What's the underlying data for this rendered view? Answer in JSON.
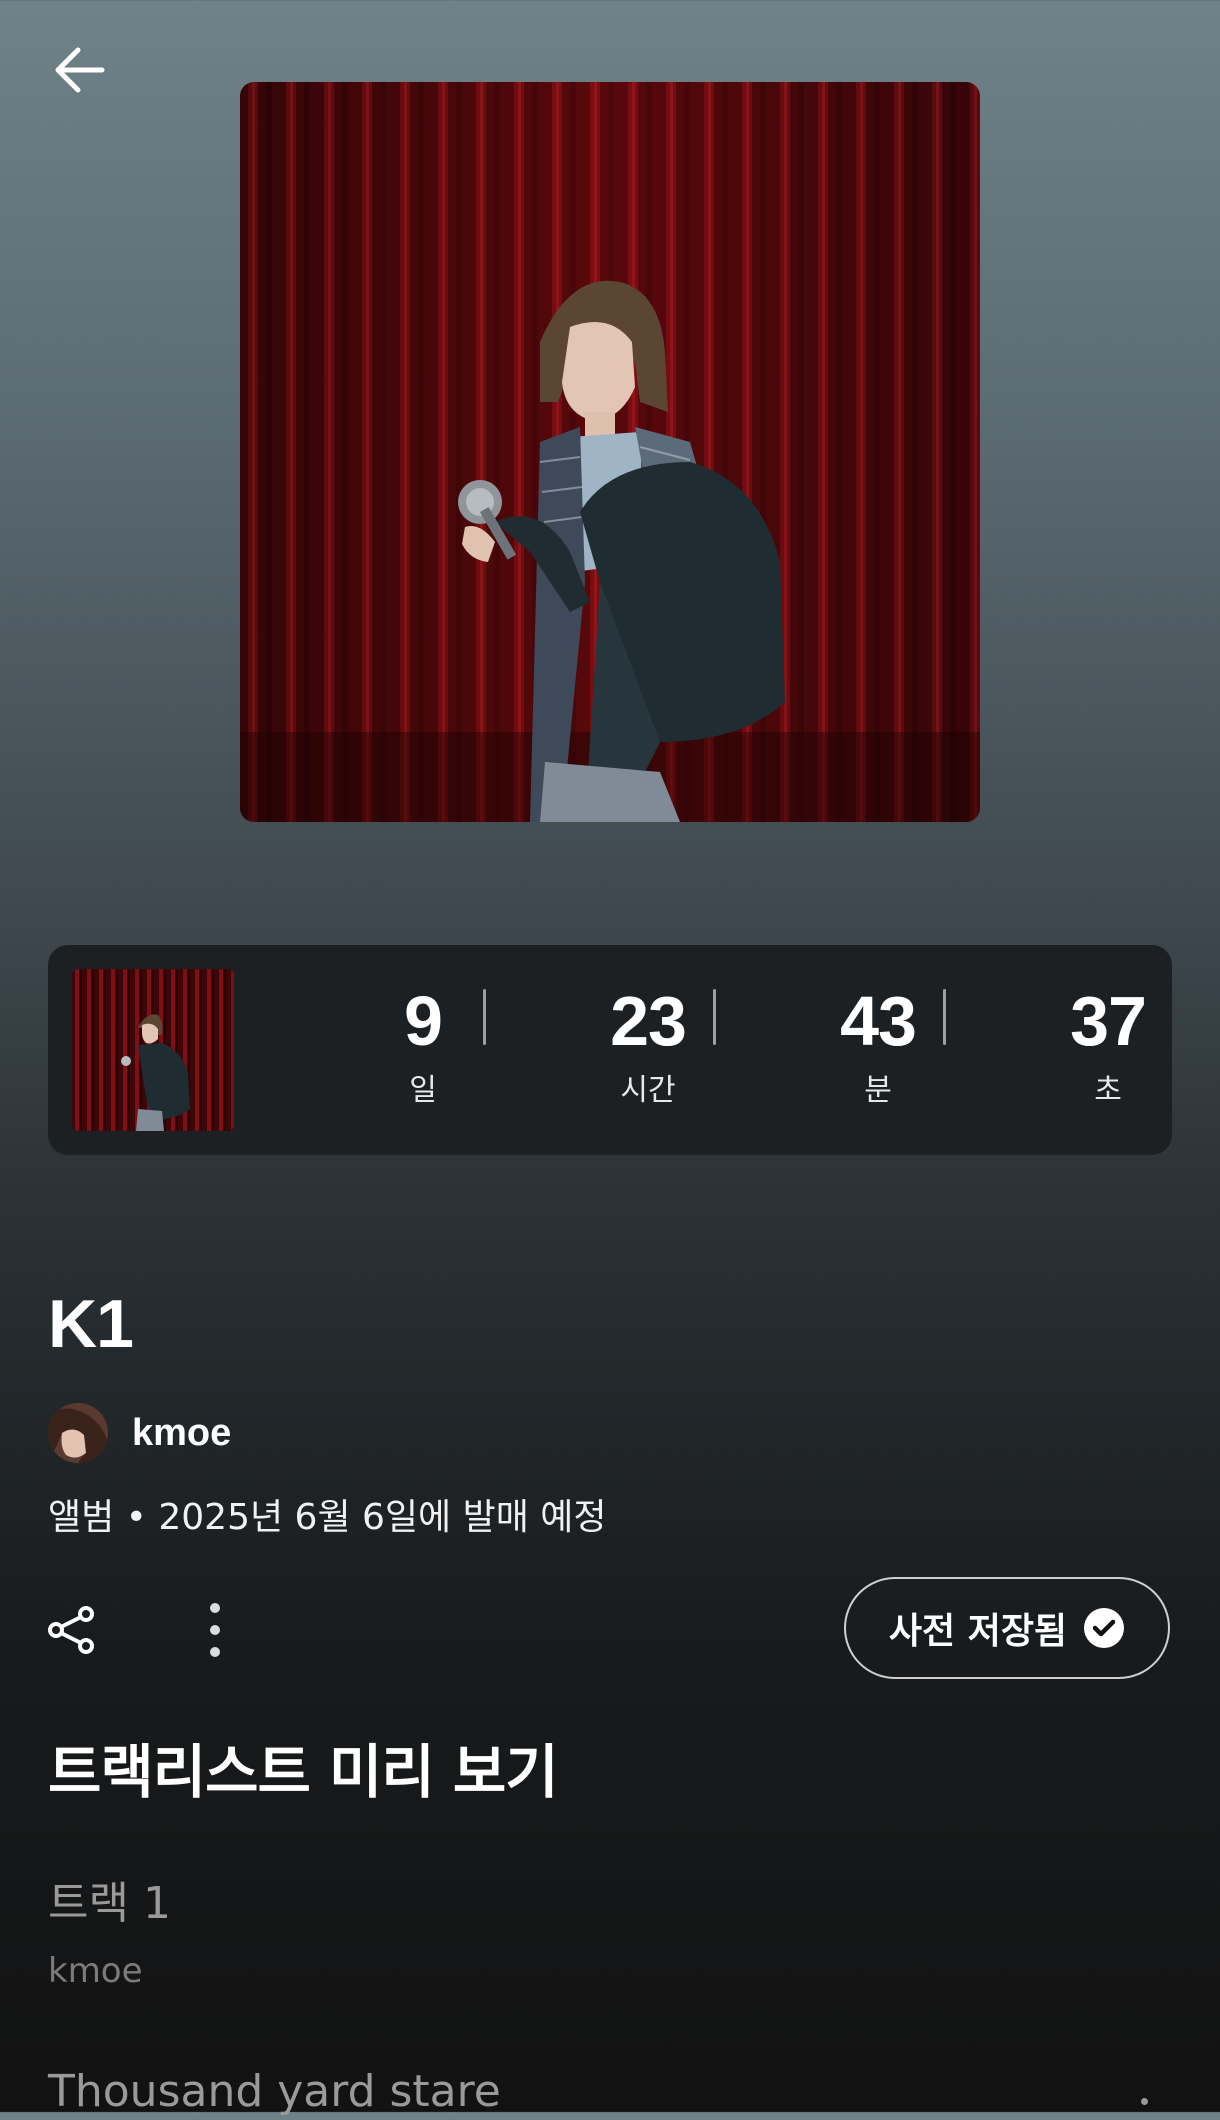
{
  "header": {
    "back_icon": "arrow-left-icon"
  },
  "album": {
    "title": "K1",
    "cover_description_icon": "album-cover-image",
    "artist": "kmoe",
    "meta": "앨범 • 2025년 6월 6일에 발매 예정"
  },
  "countdown": {
    "days": {
      "value": "9",
      "label": "일"
    },
    "hours": {
      "value": "23",
      "label": "시간"
    },
    "minutes": {
      "value": "43",
      "label": "분"
    },
    "seconds": {
      "value": "37",
      "label": "초"
    }
  },
  "actions": {
    "share_icon": "share-icon",
    "more_icon": "more-vertical-icon",
    "presave_label": "사전 저장됨",
    "presave_icon": "check-circle-icon"
  },
  "tracklist": {
    "heading": "트랙리스트 미리 보기",
    "tracks": [
      {
        "title": "트랙 1",
        "artist": "kmoe"
      },
      {
        "title": "Thousand yard stare",
        "artist": ""
      }
    ]
  },
  "colors": {
    "background_top": "#6f8288",
    "background_bottom": "#121212",
    "card": "#1c2023",
    "curtain": "#5a0a0c",
    "muted_text": "#9a9a9a"
  }
}
